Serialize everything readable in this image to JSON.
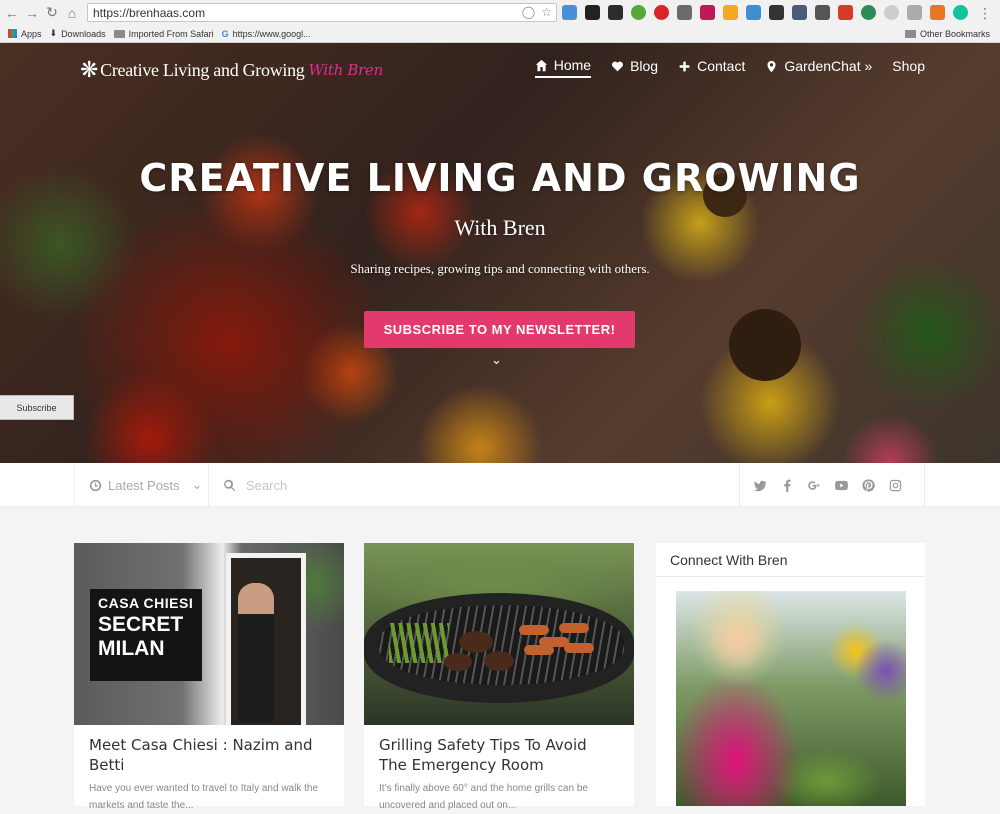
{
  "browser": {
    "url": "https://brenhaas.com",
    "bookmarks": [
      "Apps",
      "Downloads",
      "Imported From Safari",
      "https://www.googl..."
    ],
    "other_bookmarks": "Other Bookmarks"
  },
  "site": {
    "logo_text": "Creative Living and Growing",
    "logo_script": "With Bren",
    "nav": [
      {
        "label": "Home",
        "icon": "home-icon",
        "active": true
      },
      {
        "label": "Blog",
        "icon": "heart-icon",
        "active": false
      },
      {
        "label": "Contact",
        "icon": "plus-icon",
        "active": false
      },
      {
        "label": "GardenChat »",
        "icon": "map-pin-icon",
        "active": false
      },
      {
        "label": "Shop",
        "icon": "",
        "active": false
      }
    ]
  },
  "hero": {
    "title": "CREATIVE LIVING AND GROWING",
    "subtitle": "With Bren",
    "tagline": "Sharing recipes, growing tips and connecting with others.",
    "cta": "SUBSCRIBE TO MY NEWSLETTER!",
    "subscribe_tab": "Subscribe"
  },
  "filters": {
    "latest": "Latest Posts",
    "search_placeholder": "Search",
    "social": [
      "twitter-icon",
      "facebook-icon",
      "google-plus-icon",
      "youtube-icon",
      "pinterest-icon",
      "instagram-icon"
    ]
  },
  "posts": [
    {
      "plaque": [
        "CASA CHIESI",
        "SECRET",
        "MILAN"
      ],
      "title": "Meet Casa Chiesi : Nazim and Betti",
      "excerpt": "Have you ever wanted to travel to Italy and walk the markets and taste the..."
    },
    {
      "title": "Grilling Safety Tips To Avoid The Emergency Room",
      "excerpt": "It’s finally above 60° and the home grills can be uncovered and placed out on..."
    }
  ],
  "sidebar": {
    "heading": "Connect With Bren"
  },
  "colors": {
    "accent": "#e23a6d",
    "logo_script": "#e62b8a"
  }
}
